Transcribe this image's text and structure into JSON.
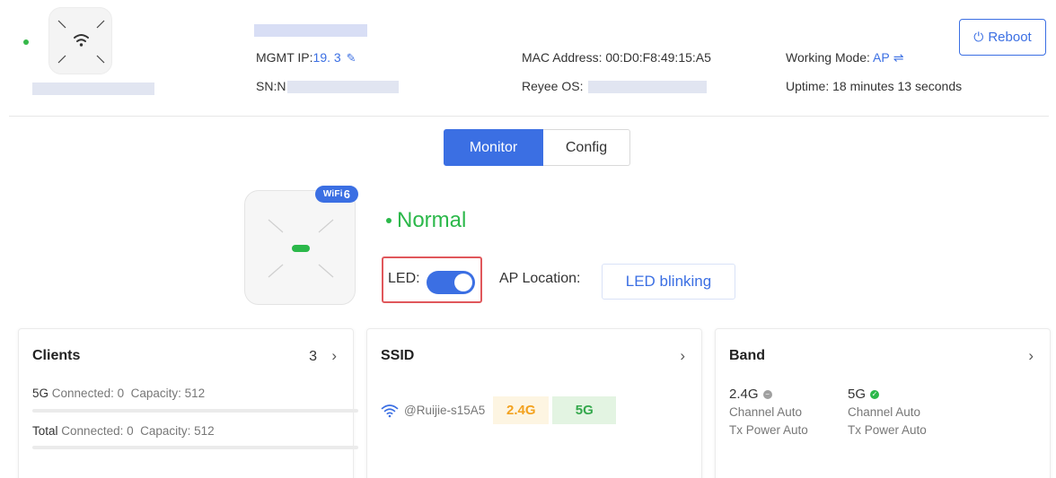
{
  "header": {
    "mgmt_ip_label": "MGMT IP:",
    "mgmt_ip_value": "19.            3",
    "sn_label": "SN:",
    "sn_value": "N",
    "mac_label": "MAC Address:",
    "mac_value": "00:D0:F8:49:15:A5",
    "os_label": "Reyee OS:",
    "mode_label": "Working Mode:",
    "mode_value": "AP",
    "uptime": "Uptime: 18 minutes 13 seconds",
    "reboot_label": "Reboot",
    "icons": [
      "wifi-icon",
      "edit-icon",
      "swap-icon",
      "power-icon"
    ]
  },
  "tabs": [
    {
      "label": "Monitor",
      "active": true
    },
    {
      "label": "Config",
      "active": false
    }
  ],
  "device": {
    "badge": "WiFi",
    "badge_num": "6",
    "status": "Normal",
    "led_label": "LED:",
    "led_on": true,
    "location_label": "AP Location:",
    "locate_button": "LED blinking"
  },
  "cards": {
    "clients": {
      "title": "Clients",
      "count": "3",
      "rows": [
        {
          "name": "5G",
          "connected": "Connected: 0",
          "capacity": "Capacity: 512"
        },
        {
          "name": "Total",
          "connected": "Connected: 0",
          "capacity": "Capacity: 512"
        }
      ]
    },
    "ssid": {
      "title": "SSID",
      "name": "@Ruijie-s15A5",
      "band_24": "2.4G",
      "band_5": "5G"
    },
    "band": {
      "title": "Band",
      "bands": [
        {
          "name": "2.4G",
          "channel": "Channel Auto",
          "power": "Tx Power Auto",
          "status_color": "#a0a0a0"
        },
        {
          "name": "5G",
          "channel": "Channel Auto",
          "power": "Tx Power Auto",
          "status_color": "#2bb84a"
        }
      ]
    }
  },
  "colors": {
    "accent": "#3b6fe3",
    "ok": "#2bb84a",
    "highlight_box": "#e0575b"
  }
}
